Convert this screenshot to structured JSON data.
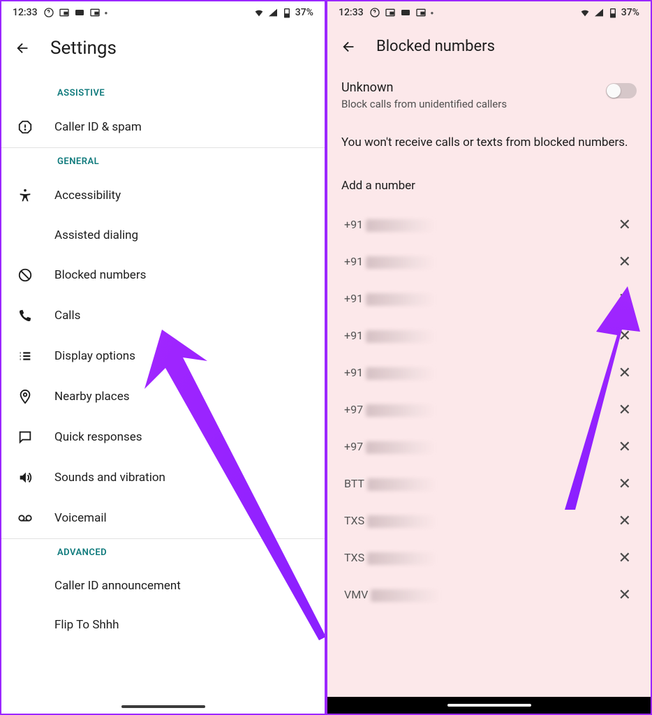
{
  "status": {
    "time": "12:33",
    "battery": "37%"
  },
  "left": {
    "title": "Settings",
    "sections": {
      "assistive": "ASSISTIVE",
      "general": "GENERAL",
      "advanced": "ADVANCED"
    },
    "items": {
      "caller_id_spam": "Caller ID & spam",
      "accessibility": "Accessibility",
      "assisted_dialing": "Assisted dialing",
      "blocked_numbers": "Blocked numbers",
      "calls": "Calls",
      "display_options": "Display options",
      "nearby_places": "Nearby places",
      "quick_responses": "Quick responses",
      "sounds_vibration": "Sounds and vibration",
      "voicemail": "Voicemail",
      "caller_id_announcement": "Caller ID announcement",
      "flip_to_shhh": "Flip To Shhh"
    }
  },
  "right": {
    "title": "Blocked numbers",
    "unknown_title": "Unknown",
    "unknown_sub": "Block calls from unidentified callers",
    "info": "You won't receive calls or texts from blocked numbers.",
    "add_number": "Add a number",
    "numbers": [
      {
        "prefix": "+91"
      },
      {
        "prefix": "+91"
      },
      {
        "prefix": "+91"
      },
      {
        "prefix": "+91"
      },
      {
        "prefix": "+91"
      },
      {
        "prefix": "+97"
      },
      {
        "prefix": "+97"
      },
      {
        "prefix": "BTT"
      },
      {
        "prefix": "TXS"
      },
      {
        "prefix": "TXS"
      },
      {
        "prefix": "VMV"
      }
    ]
  }
}
